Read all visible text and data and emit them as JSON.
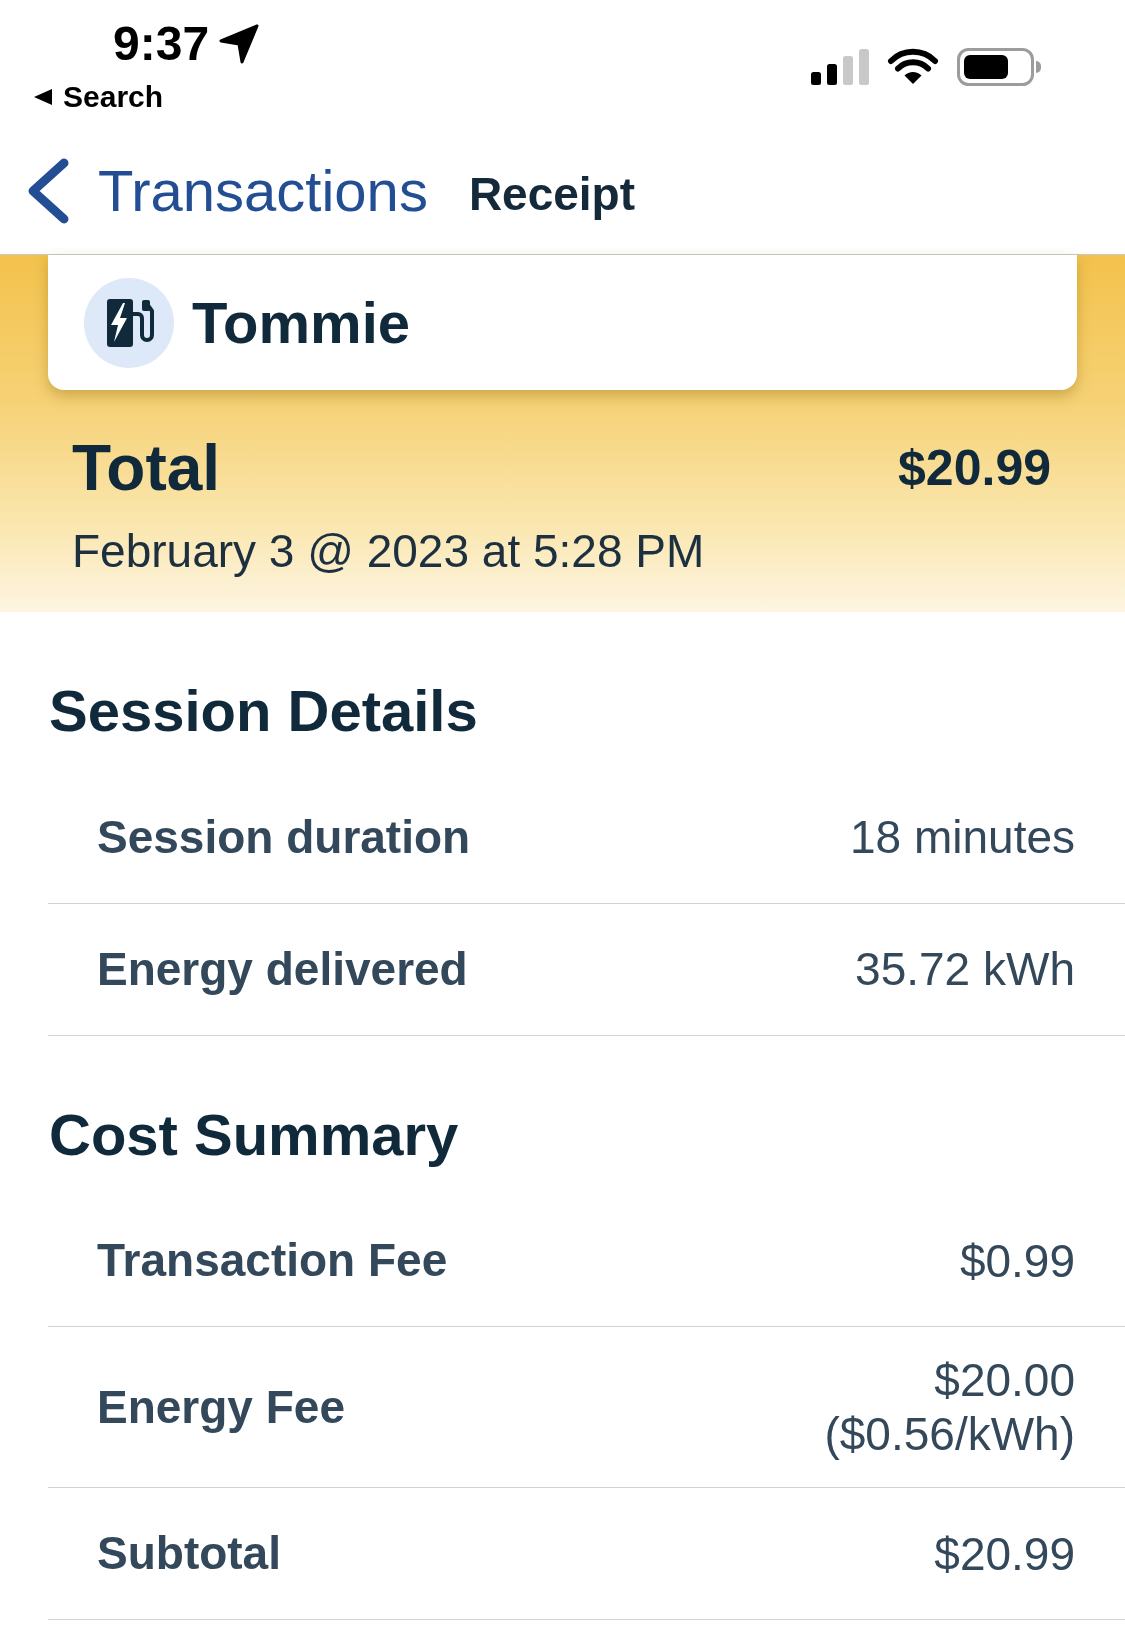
{
  "status_bar": {
    "time": "9:37",
    "back_label": "Search"
  },
  "nav": {
    "back_label": "Transactions",
    "title": "Receipt"
  },
  "station": {
    "name": "Tommie"
  },
  "total": {
    "label": "Total",
    "amount": "$20.99",
    "date": "February 3 @ 2023 at 5:28 PM"
  },
  "sections": [
    {
      "title": "Session Details",
      "rows": [
        {
          "label": "Session duration",
          "value": "18 minutes"
        },
        {
          "label": "Energy delivered",
          "value": "35.72 kWh"
        }
      ]
    },
    {
      "title": "Cost Summary",
      "rows": [
        {
          "label": "Transaction Fee",
          "value": "$0.99"
        },
        {
          "label": "Energy Fee",
          "value": "$20.00",
          "detail": "($0.56/kWh)"
        },
        {
          "label": "Subtotal",
          "value": "$20.99"
        }
      ]
    }
  ]
}
